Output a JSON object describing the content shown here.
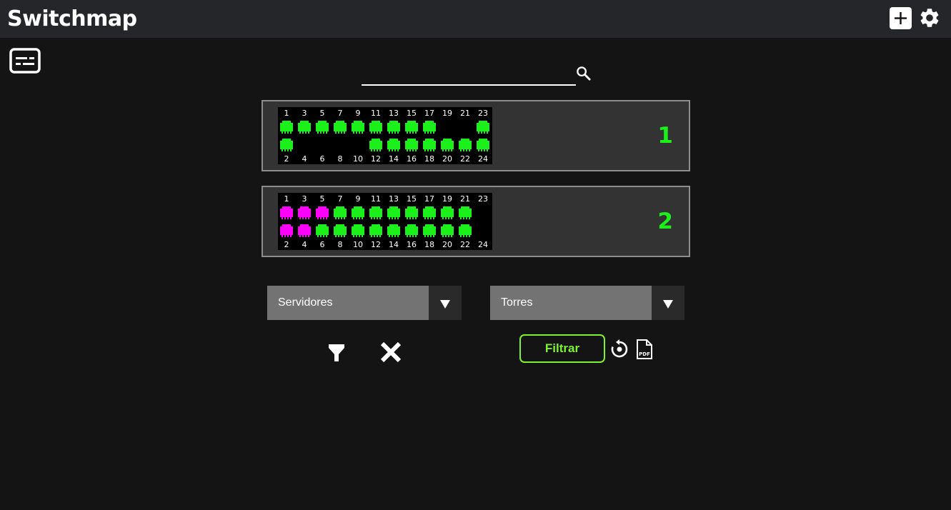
{
  "app": {
    "title": "Switchmap",
    "add_icon": "plus-square-icon",
    "settings_icon": "gear-icon",
    "list_icon": "subtitles-icon"
  },
  "search": {
    "value": "",
    "placeholder": "",
    "icon": "search-icon"
  },
  "colors": {
    "port_up": "#1bf01b",
    "port_alt": "#ff00ff",
    "switch_number": "#1bf01b",
    "filter_button": "#7cf32a"
  },
  "switches": [
    {
      "number": "1",
      "top_labels": [
        "1",
        "3",
        "5",
        "7",
        "9",
        "11",
        "13",
        "15",
        "17",
        "19",
        "21",
        "23"
      ],
      "bottom_labels": [
        "2",
        "4",
        "6",
        "8",
        "10",
        "12",
        "14",
        "16",
        "18",
        "20",
        "22",
        "24"
      ],
      "top_ports": [
        "up",
        "up",
        "up",
        "up",
        "up",
        "up",
        "up",
        "up",
        "up",
        "off",
        "off",
        "up"
      ],
      "bottom_ports": [
        "up",
        "off",
        "off",
        "off",
        "off",
        "up",
        "up",
        "up",
        "up",
        "up",
        "up",
        "up"
      ]
    },
    {
      "number": "2",
      "top_labels": [
        "1",
        "3",
        "5",
        "7",
        "9",
        "11",
        "13",
        "15",
        "17",
        "19",
        "21",
        "23"
      ],
      "bottom_labels": [
        "2",
        "4",
        "6",
        "8",
        "10",
        "12",
        "14",
        "16",
        "18",
        "20",
        "22",
        "24"
      ],
      "top_ports": [
        "alt",
        "alt",
        "alt",
        "up",
        "up",
        "up",
        "up",
        "up",
        "up",
        "up",
        "up",
        "off"
      ],
      "bottom_ports": [
        "alt",
        "alt",
        "up",
        "up",
        "up",
        "up",
        "up",
        "up",
        "up",
        "up",
        "up",
        "off"
      ]
    }
  ],
  "filters": {
    "select1": "Servidores",
    "select2": "Torres",
    "filter_icon": "funnel-icon",
    "clear_icon": "close-icon",
    "filtrar_label": "Filtrar",
    "reset_icon": "reset-icon",
    "pdf_icon": "pdf-icon"
  }
}
